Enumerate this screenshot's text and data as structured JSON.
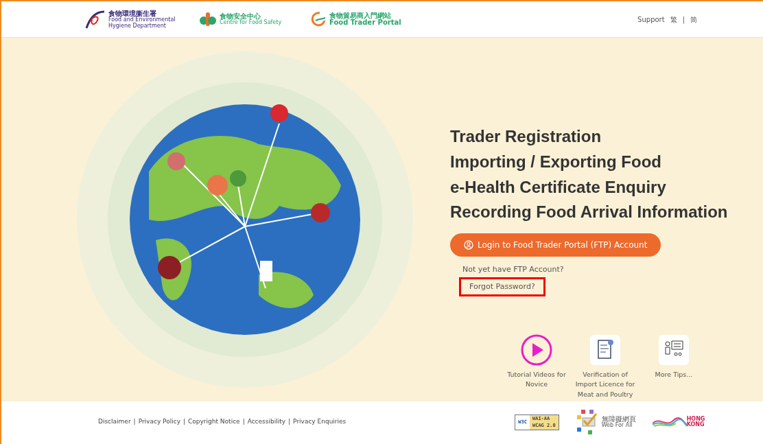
{
  "header": {
    "logos": [
      {
        "kind": "fehd",
        "chinese": "食物環境衞生署",
        "english": "Food and Environmental Hygiene Department"
      },
      {
        "kind": "cfs",
        "chinese": "食物安全中心",
        "english": "Centre for Food Safety"
      },
      {
        "kind": "ftp",
        "chinese": "食物貿易商入門網站",
        "english": "Food Trader Portal"
      }
    ],
    "support": "Support",
    "languages": [
      "繁",
      "简"
    ],
    "language_separator": "|"
  },
  "hero": {
    "headings": [
      "Trader Registration",
      "Importing / Exporting Food",
      "e-Health Certificate Enquiry",
      "Recording Food Arrival Information"
    ],
    "login_button": "Login to Food Trader Portal (FTP) Account",
    "links": [
      {
        "text": "Not yet have FTP Account?",
        "highlighted": false
      },
      {
        "text": "Forgot Password?",
        "highlighted": true
      }
    ],
    "shortcuts": [
      {
        "kind": "video",
        "label": "Tutorial Videos for Novice"
      },
      {
        "kind": "licence",
        "label": "Verification of Import Licence for Meat and Poultry"
      },
      {
        "kind": "tips",
        "label": "More Tips..."
      }
    ]
  },
  "footer": {
    "links": [
      "Disclaimer",
      "Privacy Policy",
      "Copyright Notice",
      "Accessibility",
      "Privacy Enquiries"
    ],
    "link_separator": "|",
    "badges": [
      {
        "kind": "w3c",
        "texts": [
          "W3C",
          "WAI-AA",
          "WCAG 2.0"
        ]
      },
      {
        "kind": "webforall",
        "texts": [
          "無障礙網頁",
          "Web For All"
        ]
      },
      {
        "kind": "hongkong",
        "texts": [
          "HONG KONG"
        ]
      }
    ]
  }
}
